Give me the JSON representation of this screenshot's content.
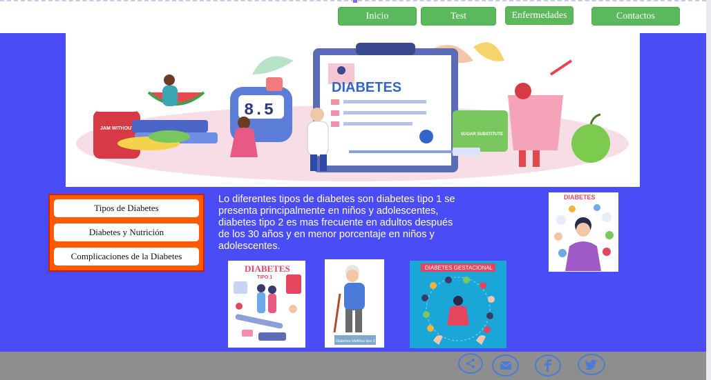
{
  "nav": {
    "items": [
      {
        "label": "Inicio"
      },
      {
        "label": "Test"
      },
      {
        "label": "Enfermedades"
      },
      {
        "label": "Contactos"
      }
    ]
  },
  "banner": {
    "title": "DIABETES",
    "reading": "8.5",
    "jar_label": "JAM WITHOUT SUGAR",
    "sugar_label": "SUGAR SUBSTITUTE"
  },
  "sidebar": {
    "items": [
      {
        "label": "Tipos de Diabetes"
      },
      {
        "label": "Diabetes y Nutrición"
      },
      {
        "label": "Complicaciones de la Diabetes"
      }
    ]
  },
  "intro": {
    "text": "Lo diferentes tipos de diabetes son diabetes tipo 1 se presenta principalmente en niños y adolescentes, diabetes tipo 2 es mas frecuente en adultos después de los 30 años y en menor porcentaje en niños y adolescentes."
  },
  "thumbs": {
    "tipo1_title": "DIABETES",
    "tipo1_sub": "TIPO 1",
    "tipo2_caption": "Diabetes Mellitus tipo 2",
    "gest_title": "DIABETES GESTACIONAL",
    "side_title": "DIABETES"
  },
  "footer": {
    "icons": [
      "share-icon",
      "mail-icon",
      "facebook-icon",
      "twitter-icon"
    ]
  },
  "colors": {
    "background": "#4a4cf5",
    "nav_button": "#5cb85c",
    "side_panel": "#ff5a00",
    "footer": "#8e8e8e"
  }
}
